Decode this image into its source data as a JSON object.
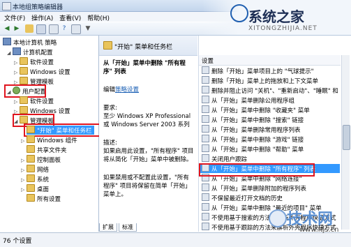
{
  "window": {
    "title": "本地组策略编辑器"
  },
  "menu": [
    "文件(F)",
    "操作(A)",
    "查看(V)",
    "帮助(H)"
  ],
  "toolbar": [
    "back-icon",
    "forward-icon",
    "up-folder-icon",
    "show-tree-icon",
    "properties-icon",
    "help-icon",
    "export-icon",
    "filter-icon"
  ],
  "tree": {
    "items": [
      {
        "label": "本地计算机 策略",
        "icon": "policy-icon",
        "level": 0
      },
      {
        "label": "计算机配置",
        "icon": "computer-icon",
        "level": 1
      },
      {
        "label": "软件设置",
        "icon": "folder-icon",
        "level": 2
      },
      {
        "label": "Windows 设置",
        "icon": "folder-icon",
        "level": 2
      },
      {
        "label": "管理模板",
        "icon": "folder-icon",
        "level": 2
      },
      {
        "label": "用户配置",
        "icon": "user-icon",
        "level": 1
      },
      {
        "label": "软件设置",
        "icon": "folder-icon",
        "level": 2
      },
      {
        "label": "Windows 设置",
        "icon": "folder-icon",
        "level": 2
      },
      {
        "label": "管理模板",
        "icon": "folder-icon",
        "level": 2
      },
      {
        "label": "\"开始\" 菜单和任务栏",
        "icon": "folder-icon",
        "level": 3
      },
      {
        "label": "Windows 组件",
        "icon": "folder-icon",
        "level": 3
      },
      {
        "label": "共享文件夹",
        "icon": "folder-icon",
        "level": 3
      },
      {
        "label": "控制面板",
        "icon": "folder-icon",
        "level": 3
      },
      {
        "label": "网络",
        "icon": "folder-icon",
        "level": 3
      },
      {
        "label": "系统",
        "icon": "folder-icon",
        "level": 3
      },
      {
        "label": "桌面",
        "icon": "folder-icon",
        "level": 3
      },
      {
        "label": "所有设置",
        "icon": "folder-icon",
        "level": 3
      }
    ]
  },
  "middle": {
    "header": "\"开始\" 菜单和任务栏",
    "title": "从「开始」菜单中删除 \"所有程序\" 列表",
    "edit_link_prefix": "编辑",
    "edit_link": "策略设置",
    "requirements_label": "要求:",
    "requirements": "至少 Windows XP Professional 或 Windows Server 2003 系列",
    "description_label": "描述:",
    "description": "如果启用此设置，\"所有程序\" 项目将从简化「开始」菜单中被删除。",
    "description2": "如果禁用或不配置此设置，\"所有程序\" 项目将保留在简单「开始」菜单上。",
    "tabs": [
      "扩展",
      "标准"
    ]
  },
  "list": {
    "column": "设置",
    "rows": [
      "删除「开始」菜单项目上的 \"气球提示\"",
      "删除「开始」菜单上的拖放和上下文菜单",
      "删除并阻止访问 \"关机\"、\"重新启动\"、\"睡眠\" 和",
      "从「开始」菜单删除公用程序组",
      "从「开始」菜单中删除 \"收藏夹\" 菜单",
      "从「开始」菜单中删除 \"搜索\" 链接",
      "从「开始」菜单删除常用程序列表",
      "从「开始」菜单中删除 \"游戏\" 链接",
      "从「开始」菜单中删除 \"帮助\" 菜单",
      "关闭用户跟踪",
      "从「开始」菜单中删除 \"所有程序\" 列表",
      "从「开始」菜单中删除 \"网络连接\"",
      "从「开始」菜单删除附加的程序列表",
      "不保留最近打开文档的历史",
      "从「开始」菜单中删除 \"最近的项目\" 菜单",
      "不使用基于搜索的方法来解析外壳程序快捷方式",
      "不使用基于跟踪的方法来解析外壳程序快捷方式",
      "从「开始」菜单中删除 \"运行\" 菜单"
    ],
    "selected_index": 10
  },
  "status": {
    "text": "76 个设置"
  },
  "watermark_top": {
    "brand": "系统之家",
    "url": "XITONGZHIJIA.NET"
  },
  "watermark_bottom": {
    "brand": "技术网",
    "url": "www.itjs.cn"
  }
}
